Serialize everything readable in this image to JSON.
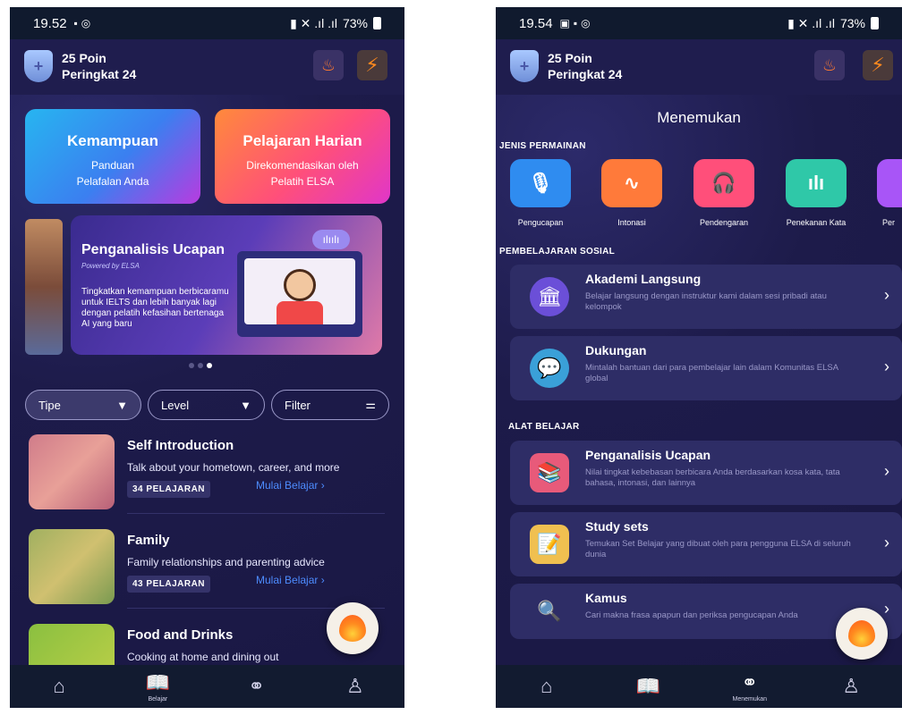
{
  "left": {
    "status": {
      "time": "19.52",
      "battery": "73%"
    },
    "header": {
      "points": "25 Poin",
      "rank": "Peringkat 24"
    },
    "cards": {
      "kemampuan": {
        "title": "Kemampuan",
        "line1": "Panduan",
        "line2": "Pelafalan Anda"
      },
      "harian": {
        "title": "Pelajaran Harian",
        "line1": "Direkomendasikan oleh",
        "line2": "Pelatih ELSA"
      }
    },
    "analyzer": {
      "title": "Penganalisis Ucapan",
      "powered": "Powered by ELSA",
      "description": "Tingkatkan kemampuan berbicaramu untuk IELTS dan lebih banyak lagi dengan pelatih kefasihan bertenaga AI yang baru"
    },
    "filters": {
      "tipe": "Tipe",
      "level": "Level",
      "filter": "Filter"
    },
    "lessons": [
      {
        "title": "Self Introduction",
        "desc": "Talk about your hometown, career, and more",
        "count": "34 PELAJARAN",
        "cta": "Mulai Belajar"
      },
      {
        "title": "Family",
        "desc": "Family relationships and parenting advice",
        "count": "43 PELAJARAN",
        "cta": "Mulai Belajar"
      },
      {
        "title": "Food and Drinks",
        "desc": "Cooking at home and dining out"
      }
    ],
    "nav": {
      "active_label": "Belajar"
    }
  },
  "right": {
    "status": {
      "time": "19.54",
      "battery": "73%"
    },
    "header": {
      "points": "25 Poin",
      "rank": "Peringkat 24"
    },
    "page_title": "Menemukan",
    "section_games": "JENIS PERMAINAN",
    "games": [
      {
        "label": "Pengucapan",
        "color": "#2f8cf0"
      },
      {
        "label": "Intonasi",
        "color": "#ff7a3a"
      },
      {
        "label": "Pendengaran",
        "color": "#ff4f7a"
      },
      {
        "label": "Penekanan Kata",
        "color": "#2fc8a8"
      },
      {
        "label": "Per",
        "color": "#a855f7"
      }
    ],
    "section_social": "PEMBELAJARAN SOSIAL",
    "social": [
      {
        "title": "Akademi Langsung",
        "desc": "Belajar langsung dengan instruktur kami dalam sesi pribadi atau kelompok"
      },
      {
        "title": "Dukungan",
        "desc": "Mintalah bantuan dari para pembelajar lain dalam Komunitas ELSA global"
      }
    ],
    "section_tools": "ALAT BELAJAR",
    "tools": [
      {
        "title": "Penganalisis Ucapan",
        "desc": "Nilai tingkat kebebasan berbicara Anda berdasarkan kosa kata, tata bahasa, intonasi, dan lainnya"
      },
      {
        "title": "Study sets",
        "desc": "Temukan Set Belajar yang dibuat oleh para pengguna ELSA di seluruh dunia"
      },
      {
        "title": "Kamus",
        "desc": "Cari makna frasa apapun dan periksa pengucapan Anda"
      }
    ],
    "nav": {
      "active_label": "Menemukan"
    }
  },
  "colors": {
    "background": "#1c1b4a",
    "link": "#4d8cff",
    "accent": "#ff8a1f"
  }
}
